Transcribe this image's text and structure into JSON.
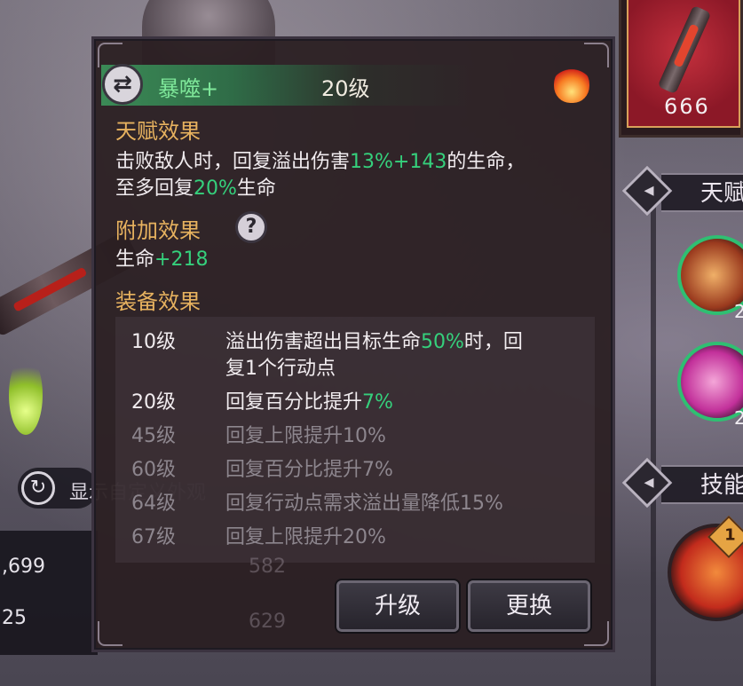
{
  "talent": {
    "name": "暴噬+",
    "level": "20级",
    "icon": "crossed-arrows-icon",
    "element_icon": "fire-icon"
  },
  "talent_effect": {
    "title": "天赋效果",
    "line1_pre": "击败敌人时，回复溢出伤害",
    "line1_value": "13%+143",
    "line1_post": "的生命，",
    "line2_pre": "至多回复",
    "line2_value": "20%",
    "line2_post": "生命"
  },
  "bonus_effect": {
    "title": "附加效果",
    "help_icon": "?",
    "stat_label": "生命",
    "stat_value": "+218"
  },
  "equip_effect": {
    "title": "装备效果",
    "rows": [
      {
        "level": "10级",
        "pre": "溢出伤害超出目标生命",
        "value": "50%",
        "post": "时，回",
        "line2": "复1个行动点",
        "unlocked": true
      },
      {
        "level": "20级",
        "pre": "回复百分比提升",
        "value": "7%",
        "post": "",
        "unlocked": true
      },
      {
        "level": "45级",
        "text": "回复上限提升10%",
        "unlocked": false
      },
      {
        "level": "60级",
        "text": "回复百分比提升7%",
        "unlocked": false
      },
      {
        "level": "64级",
        "text": "回复行动点需求溢出量降低15%",
        "unlocked": false
      },
      {
        "level": "67级",
        "text": "回复上限提升20%",
        "unlocked": false
      }
    ]
  },
  "buttons": {
    "upgrade": "升级",
    "replace": "更换"
  },
  "background": {
    "toggle_label": "显示自定义外观",
    "stat1": ",699",
    "stat2": "25",
    "faint_val1": "582",
    "faint_val2": "629",
    "section1": "天赋",
    "section2": "技能",
    "skill_lvl1": "2",
    "skill_lvl2": "2",
    "skill_badge": "1",
    "card_pips": "666"
  },
  "colors": {
    "accent_green": "#35d07c",
    "section_gold": "#e7b25f",
    "locked_gray": "#8d868e"
  }
}
